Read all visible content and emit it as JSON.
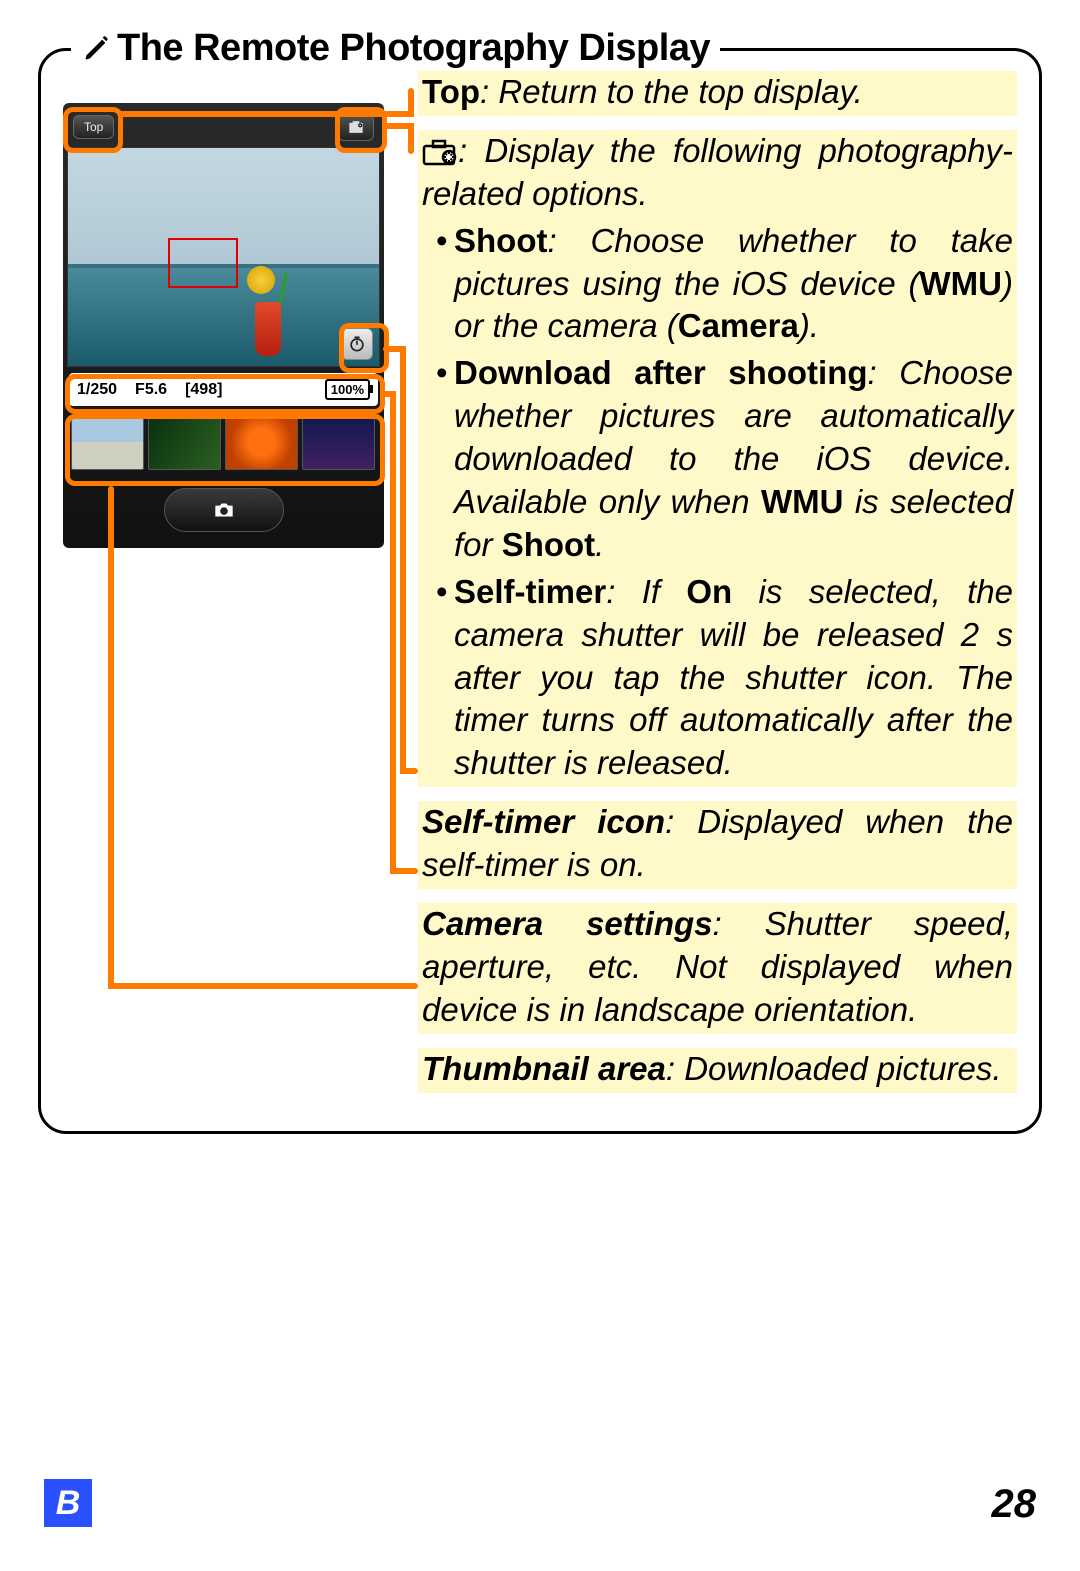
{
  "panel": {
    "title": "The Remote Photography Display"
  },
  "phone": {
    "top_button": "Top",
    "shutter_speed": "1/250",
    "aperture": "F5.6",
    "shots_remaining": "[498]",
    "battery": "100%"
  },
  "callouts": {
    "top": {
      "lead": "Top",
      "body": ": Return to the top display."
    },
    "options": {
      "body_intro": ": Display the following photography-related options.",
      "shoot": {
        "lead": "Shoot",
        "body_1": ": Choose whether to take pictures using the iOS device (",
        "wmu": "WMU",
        "body_2": ") or the camera (",
        "camera": "Camera",
        "body_3": ")."
      },
      "download": {
        "lead": "Download after shooting",
        "body_1": ": Choose whether pictures are automatically downloaded to the iOS device. Available only when ",
        "wmu": "WMU",
        "body_2": " is selected for ",
        "shoot": "Shoot",
        "body_3": "."
      },
      "selftimer": {
        "lead": "Self-timer",
        "body_1": ": If ",
        "on": "On",
        "body_2": " is selected, the camera shutter will be released 2 s after you tap the shutter icon. The timer turns off automatically after the shutter is released."
      }
    },
    "selftimer_icon": {
      "lead": "Self-timer icon",
      "body": ": Displayed when the self-timer is on."
    },
    "camera_settings": {
      "lead": "Camera settings",
      "body": ": Shutter speed, aperture, etc. Not displayed when device is in landscape orientation."
    },
    "thumbnails": {
      "lead": "Thumbnail area",
      "body": ": Downloaded pictures."
    }
  },
  "footer": {
    "section": "B",
    "page": "28"
  }
}
